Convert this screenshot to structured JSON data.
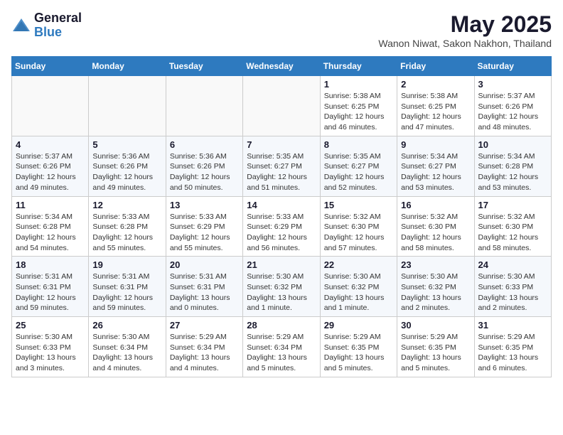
{
  "header": {
    "logo_general": "General",
    "logo_blue": "Blue",
    "month_title": "May 2025",
    "location": "Wanon Niwat, Sakon Nakhon, Thailand"
  },
  "weekdays": [
    "Sunday",
    "Monday",
    "Tuesday",
    "Wednesday",
    "Thursday",
    "Friday",
    "Saturday"
  ],
  "weeks": [
    [
      {
        "day": "",
        "info": ""
      },
      {
        "day": "",
        "info": ""
      },
      {
        "day": "",
        "info": ""
      },
      {
        "day": "",
        "info": ""
      },
      {
        "day": "1",
        "info": "Sunrise: 5:38 AM\nSunset: 6:25 PM\nDaylight: 12 hours\nand 46 minutes."
      },
      {
        "day": "2",
        "info": "Sunrise: 5:38 AM\nSunset: 6:25 PM\nDaylight: 12 hours\nand 47 minutes."
      },
      {
        "day": "3",
        "info": "Sunrise: 5:37 AM\nSunset: 6:26 PM\nDaylight: 12 hours\nand 48 minutes."
      }
    ],
    [
      {
        "day": "4",
        "info": "Sunrise: 5:37 AM\nSunset: 6:26 PM\nDaylight: 12 hours\nand 49 minutes."
      },
      {
        "day": "5",
        "info": "Sunrise: 5:36 AM\nSunset: 6:26 PM\nDaylight: 12 hours\nand 49 minutes."
      },
      {
        "day": "6",
        "info": "Sunrise: 5:36 AM\nSunset: 6:26 PM\nDaylight: 12 hours\nand 50 minutes."
      },
      {
        "day": "7",
        "info": "Sunrise: 5:35 AM\nSunset: 6:27 PM\nDaylight: 12 hours\nand 51 minutes."
      },
      {
        "day": "8",
        "info": "Sunrise: 5:35 AM\nSunset: 6:27 PM\nDaylight: 12 hours\nand 52 minutes."
      },
      {
        "day": "9",
        "info": "Sunrise: 5:34 AM\nSunset: 6:27 PM\nDaylight: 12 hours\nand 53 minutes."
      },
      {
        "day": "10",
        "info": "Sunrise: 5:34 AM\nSunset: 6:28 PM\nDaylight: 12 hours\nand 53 minutes."
      }
    ],
    [
      {
        "day": "11",
        "info": "Sunrise: 5:34 AM\nSunset: 6:28 PM\nDaylight: 12 hours\nand 54 minutes."
      },
      {
        "day": "12",
        "info": "Sunrise: 5:33 AM\nSunset: 6:28 PM\nDaylight: 12 hours\nand 55 minutes."
      },
      {
        "day": "13",
        "info": "Sunrise: 5:33 AM\nSunset: 6:29 PM\nDaylight: 12 hours\nand 55 minutes."
      },
      {
        "day": "14",
        "info": "Sunrise: 5:33 AM\nSunset: 6:29 PM\nDaylight: 12 hours\nand 56 minutes."
      },
      {
        "day": "15",
        "info": "Sunrise: 5:32 AM\nSunset: 6:30 PM\nDaylight: 12 hours\nand 57 minutes."
      },
      {
        "day": "16",
        "info": "Sunrise: 5:32 AM\nSunset: 6:30 PM\nDaylight: 12 hours\nand 58 minutes."
      },
      {
        "day": "17",
        "info": "Sunrise: 5:32 AM\nSunset: 6:30 PM\nDaylight: 12 hours\nand 58 minutes."
      }
    ],
    [
      {
        "day": "18",
        "info": "Sunrise: 5:31 AM\nSunset: 6:31 PM\nDaylight: 12 hours\nand 59 minutes."
      },
      {
        "day": "19",
        "info": "Sunrise: 5:31 AM\nSunset: 6:31 PM\nDaylight: 12 hours\nand 59 minutes."
      },
      {
        "day": "20",
        "info": "Sunrise: 5:31 AM\nSunset: 6:31 PM\nDaylight: 13 hours\nand 0 minutes."
      },
      {
        "day": "21",
        "info": "Sunrise: 5:30 AM\nSunset: 6:32 PM\nDaylight: 13 hours\nand 1 minute."
      },
      {
        "day": "22",
        "info": "Sunrise: 5:30 AM\nSunset: 6:32 PM\nDaylight: 13 hours\nand 1 minute."
      },
      {
        "day": "23",
        "info": "Sunrise: 5:30 AM\nSunset: 6:32 PM\nDaylight: 13 hours\nand 2 minutes."
      },
      {
        "day": "24",
        "info": "Sunrise: 5:30 AM\nSunset: 6:33 PM\nDaylight: 13 hours\nand 2 minutes."
      }
    ],
    [
      {
        "day": "25",
        "info": "Sunrise: 5:30 AM\nSunset: 6:33 PM\nDaylight: 13 hours\nand 3 minutes."
      },
      {
        "day": "26",
        "info": "Sunrise: 5:30 AM\nSunset: 6:34 PM\nDaylight: 13 hours\nand 4 minutes."
      },
      {
        "day": "27",
        "info": "Sunrise: 5:29 AM\nSunset: 6:34 PM\nDaylight: 13 hours\nand 4 minutes."
      },
      {
        "day": "28",
        "info": "Sunrise: 5:29 AM\nSunset: 6:34 PM\nDaylight: 13 hours\nand 5 minutes."
      },
      {
        "day": "29",
        "info": "Sunrise: 5:29 AM\nSunset: 6:35 PM\nDaylight: 13 hours\nand 5 minutes."
      },
      {
        "day": "30",
        "info": "Sunrise: 5:29 AM\nSunset: 6:35 PM\nDaylight: 13 hours\nand 5 minutes."
      },
      {
        "day": "31",
        "info": "Sunrise: 5:29 AM\nSunset: 6:35 PM\nDaylight: 13 hours\nand 6 minutes."
      }
    ]
  ]
}
